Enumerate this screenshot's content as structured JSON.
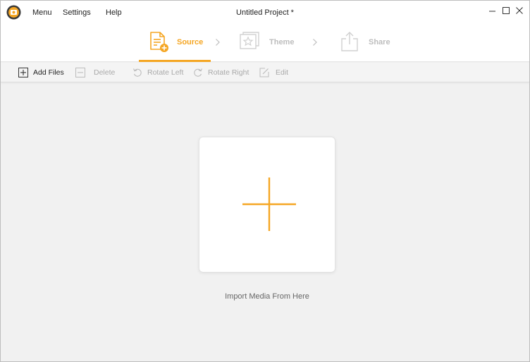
{
  "window": {
    "title": "Untitled Project *",
    "accent_color": "#f5a623",
    "app_icon": "app-logo-icon"
  },
  "menu": {
    "items": [
      {
        "label": "Menu"
      },
      {
        "label": "Settings"
      },
      {
        "label": "Help"
      }
    ]
  },
  "window_controls": {
    "minimize_icon": "minimize-icon",
    "maximize_icon": "maximize-icon",
    "close_icon": "close-icon"
  },
  "steps": [
    {
      "label": "Source",
      "icon": "document-add-icon",
      "active": true
    },
    {
      "label": "Theme",
      "icon": "theme-star-icon",
      "active": false
    },
    {
      "label": "Share",
      "icon": "share-icon",
      "active": false
    }
  ],
  "toolbar": {
    "items": [
      {
        "label": "Add Files",
        "icon": "add-box-icon",
        "enabled": true
      },
      {
        "label": "Delete",
        "icon": "minus-box-icon",
        "enabled": false
      },
      {
        "label": "Rotate Left",
        "icon": "rotate-left-icon",
        "enabled": false
      },
      {
        "label": "Rotate Right",
        "icon": "rotate-right-icon",
        "enabled": false
      },
      {
        "label": "Edit",
        "icon": "edit-icon",
        "enabled": false
      }
    ]
  },
  "main": {
    "import_label": "Import Media From Here",
    "import_icon": "plus-icon"
  }
}
